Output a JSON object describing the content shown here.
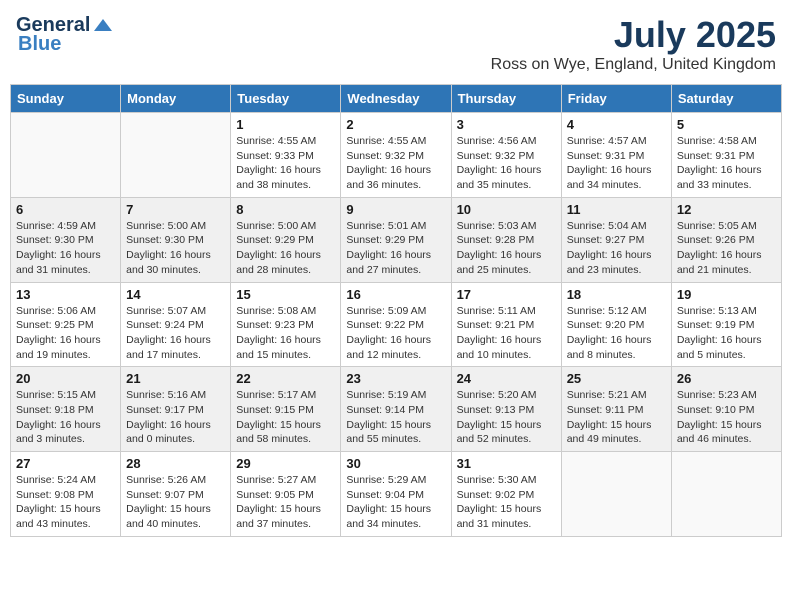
{
  "header": {
    "logo_general": "General",
    "logo_blue": "Blue",
    "month_year": "July 2025",
    "location": "Ross on Wye, England, United Kingdom"
  },
  "days_of_week": [
    "Sunday",
    "Monday",
    "Tuesday",
    "Wednesday",
    "Thursday",
    "Friday",
    "Saturday"
  ],
  "weeks": [
    [
      {
        "day": "",
        "sunrise": "",
        "sunset": "",
        "daylight": ""
      },
      {
        "day": "",
        "sunrise": "",
        "sunset": "",
        "daylight": ""
      },
      {
        "day": "1",
        "sunrise": "Sunrise: 4:55 AM",
        "sunset": "Sunset: 9:33 PM",
        "daylight": "Daylight: 16 hours and 38 minutes."
      },
      {
        "day": "2",
        "sunrise": "Sunrise: 4:55 AM",
        "sunset": "Sunset: 9:32 PM",
        "daylight": "Daylight: 16 hours and 36 minutes."
      },
      {
        "day": "3",
        "sunrise": "Sunrise: 4:56 AM",
        "sunset": "Sunset: 9:32 PM",
        "daylight": "Daylight: 16 hours and 35 minutes."
      },
      {
        "day": "4",
        "sunrise": "Sunrise: 4:57 AM",
        "sunset": "Sunset: 9:31 PM",
        "daylight": "Daylight: 16 hours and 34 minutes."
      },
      {
        "day": "5",
        "sunrise": "Sunrise: 4:58 AM",
        "sunset": "Sunset: 9:31 PM",
        "daylight": "Daylight: 16 hours and 33 minutes."
      }
    ],
    [
      {
        "day": "6",
        "sunrise": "Sunrise: 4:59 AM",
        "sunset": "Sunset: 9:30 PM",
        "daylight": "Daylight: 16 hours and 31 minutes."
      },
      {
        "day": "7",
        "sunrise": "Sunrise: 5:00 AM",
        "sunset": "Sunset: 9:30 PM",
        "daylight": "Daylight: 16 hours and 30 minutes."
      },
      {
        "day": "8",
        "sunrise": "Sunrise: 5:00 AM",
        "sunset": "Sunset: 9:29 PM",
        "daylight": "Daylight: 16 hours and 28 minutes."
      },
      {
        "day": "9",
        "sunrise": "Sunrise: 5:01 AM",
        "sunset": "Sunset: 9:29 PM",
        "daylight": "Daylight: 16 hours and 27 minutes."
      },
      {
        "day": "10",
        "sunrise": "Sunrise: 5:03 AM",
        "sunset": "Sunset: 9:28 PM",
        "daylight": "Daylight: 16 hours and 25 minutes."
      },
      {
        "day": "11",
        "sunrise": "Sunrise: 5:04 AM",
        "sunset": "Sunset: 9:27 PM",
        "daylight": "Daylight: 16 hours and 23 minutes."
      },
      {
        "day": "12",
        "sunrise": "Sunrise: 5:05 AM",
        "sunset": "Sunset: 9:26 PM",
        "daylight": "Daylight: 16 hours and 21 minutes."
      }
    ],
    [
      {
        "day": "13",
        "sunrise": "Sunrise: 5:06 AM",
        "sunset": "Sunset: 9:25 PM",
        "daylight": "Daylight: 16 hours and 19 minutes."
      },
      {
        "day": "14",
        "sunrise": "Sunrise: 5:07 AM",
        "sunset": "Sunset: 9:24 PM",
        "daylight": "Daylight: 16 hours and 17 minutes."
      },
      {
        "day": "15",
        "sunrise": "Sunrise: 5:08 AM",
        "sunset": "Sunset: 9:23 PM",
        "daylight": "Daylight: 16 hours and 15 minutes."
      },
      {
        "day": "16",
        "sunrise": "Sunrise: 5:09 AM",
        "sunset": "Sunset: 9:22 PM",
        "daylight": "Daylight: 16 hours and 12 minutes."
      },
      {
        "day": "17",
        "sunrise": "Sunrise: 5:11 AM",
        "sunset": "Sunset: 9:21 PM",
        "daylight": "Daylight: 16 hours and 10 minutes."
      },
      {
        "day": "18",
        "sunrise": "Sunrise: 5:12 AM",
        "sunset": "Sunset: 9:20 PM",
        "daylight": "Daylight: 16 hours and 8 minutes."
      },
      {
        "day": "19",
        "sunrise": "Sunrise: 5:13 AM",
        "sunset": "Sunset: 9:19 PM",
        "daylight": "Daylight: 16 hours and 5 minutes."
      }
    ],
    [
      {
        "day": "20",
        "sunrise": "Sunrise: 5:15 AM",
        "sunset": "Sunset: 9:18 PM",
        "daylight": "Daylight: 16 hours and 3 minutes."
      },
      {
        "day": "21",
        "sunrise": "Sunrise: 5:16 AM",
        "sunset": "Sunset: 9:17 PM",
        "daylight": "Daylight: 16 hours and 0 minutes."
      },
      {
        "day": "22",
        "sunrise": "Sunrise: 5:17 AM",
        "sunset": "Sunset: 9:15 PM",
        "daylight": "Daylight: 15 hours and 58 minutes."
      },
      {
        "day": "23",
        "sunrise": "Sunrise: 5:19 AM",
        "sunset": "Sunset: 9:14 PM",
        "daylight": "Daylight: 15 hours and 55 minutes."
      },
      {
        "day": "24",
        "sunrise": "Sunrise: 5:20 AM",
        "sunset": "Sunset: 9:13 PM",
        "daylight": "Daylight: 15 hours and 52 minutes."
      },
      {
        "day": "25",
        "sunrise": "Sunrise: 5:21 AM",
        "sunset": "Sunset: 9:11 PM",
        "daylight": "Daylight: 15 hours and 49 minutes."
      },
      {
        "day": "26",
        "sunrise": "Sunrise: 5:23 AM",
        "sunset": "Sunset: 9:10 PM",
        "daylight": "Daylight: 15 hours and 46 minutes."
      }
    ],
    [
      {
        "day": "27",
        "sunrise": "Sunrise: 5:24 AM",
        "sunset": "Sunset: 9:08 PM",
        "daylight": "Daylight: 15 hours and 43 minutes."
      },
      {
        "day": "28",
        "sunrise": "Sunrise: 5:26 AM",
        "sunset": "Sunset: 9:07 PM",
        "daylight": "Daylight: 15 hours and 40 minutes."
      },
      {
        "day": "29",
        "sunrise": "Sunrise: 5:27 AM",
        "sunset": "Sunset: 9:05 PM",
        "daylight": "Daylight: 15 hours and 37 minutes."
      },
      {
        "day": "30",
        "sunrise": "Sunrise: 5:29 AM",
        "sunset": "Sunset: 9:04 PM",
        "daylight": "Daylight: 15 hours and 34 minutes."
      },
      {
        "day": "31",
        "sunrise": "Sunrise: 5:30 AM",
        "sunset": "Sunset: 9:02 PM",
        "daylight": "Daylight: 15 hours and 31 minutes."
      },
      {
        "day": "",
        "sunrise": "",
        "sunset": "",
        "daylight": ""
      },
      {
        "day": "",
        "sunrise": "",
        "sunset": "",
        "daylight": ""
      }
    ]
  ]
}
